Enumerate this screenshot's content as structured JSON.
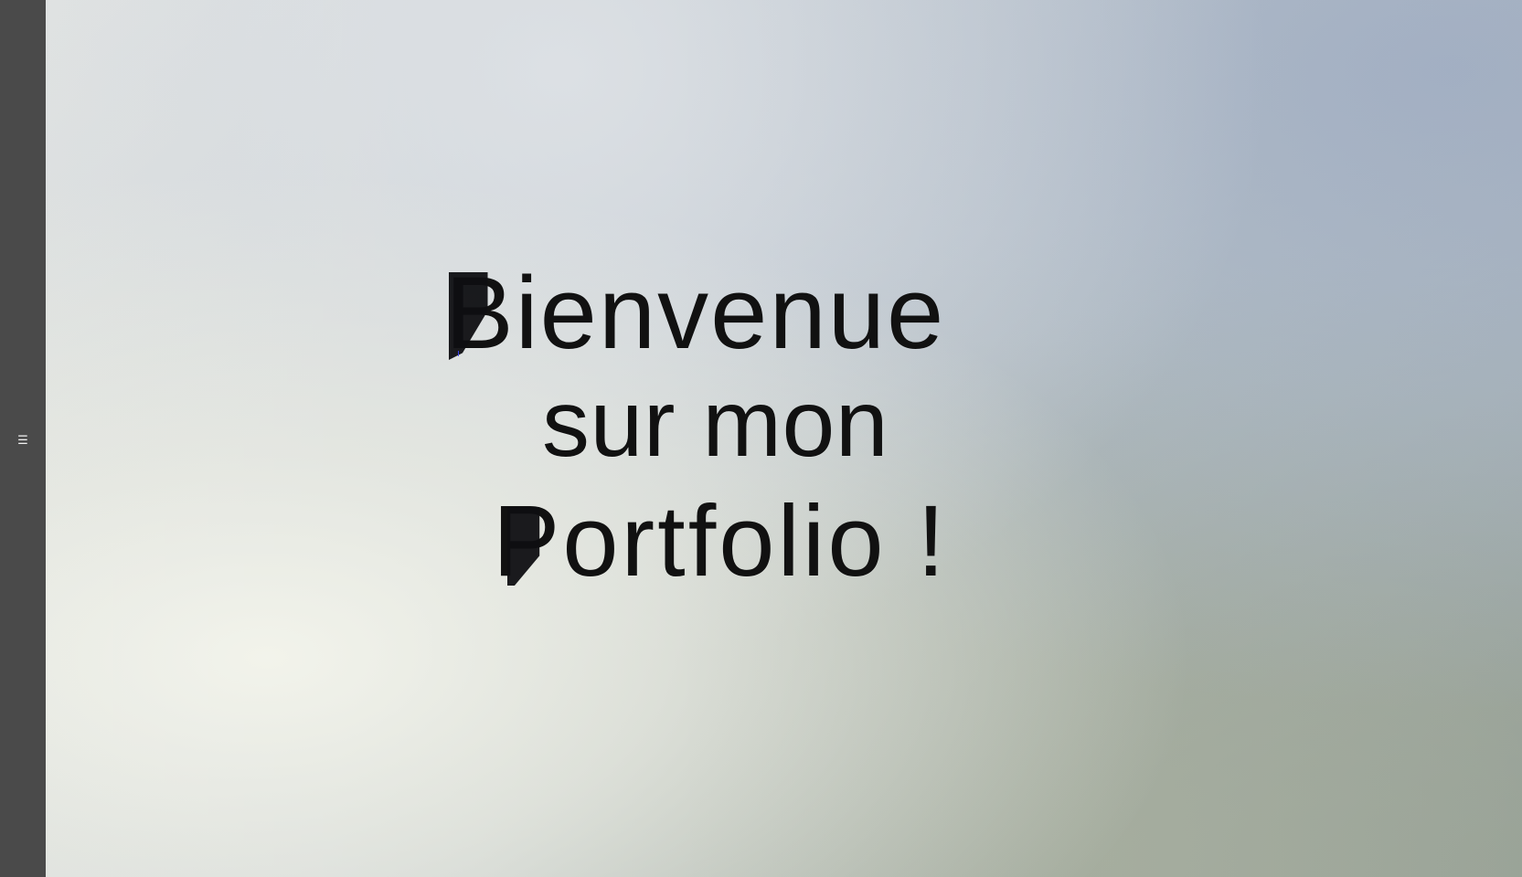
{
  "sidebar": {
    "menu_icon": "☰"
  },
  "hero": {
    "line_1": "Bienvenue",
    "line_2": "sur mon",
    "line_3": "Portfolio !"
  },
  "colors": {
    "sidebar": "#4a4a4a",
    "text": "#111111"
  },
  "icons": {
    "menu": "menu-icon"
  }
}
